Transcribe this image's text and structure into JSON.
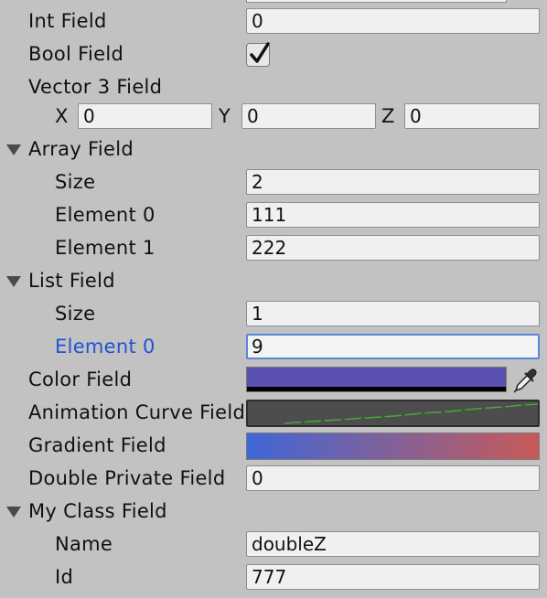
{
  "int_field": {
    "label": "Int Field",
    "value": "0"
  },
  "bool_field": {
    "label": "Bool Field",
    "checked": true
  },
  "vector3_field": {
    "label": "Vector 3 Field",
    "x_label": "X",
    "x_value": "0",
    "y_label": "Y",
    "y_value": "0",
    "z_label": "Z",
    "z_value": "0"
  },
  "array_field": {
    "label": "Array Field",
    "size_label": "Size",
    "size_value": "2",
    "elements": [
      {
        "label": "Element 0",
        "value": "111"
      },
      {
        "label": "Element 1",
        "value": "222"
      }
    ]
  },
  "list_field": {
    "label": "List Field",
    "size_label": "Size",
    "size_value": "1",
    "elements": [
      {
        "label": "Element 0",
        "value": "9"
      }
    ]
  },
  "color_field": {
    "label": "Color Field",
    "color": "#5b51b0"
  },
  "animation_curve_field": {
    "label": "Animation Curve Field",
    "curve_color": "#3fae2e"
  },
  "gradient_field": {
    "label": "Gradient Field",
    "start_color": "#3f67d8",
    "end_color": "#c85a58"
  },
  "double_private_field": {
    "label": "Double Private Field",
    "value": "0"
  },
  "my_class_field": {
    "label": "My Class Field",
    "name_label": "Name",
    "name_value": "doubleZ",
    "id_label": "Id",
    "id_value": "777"
  }
}
